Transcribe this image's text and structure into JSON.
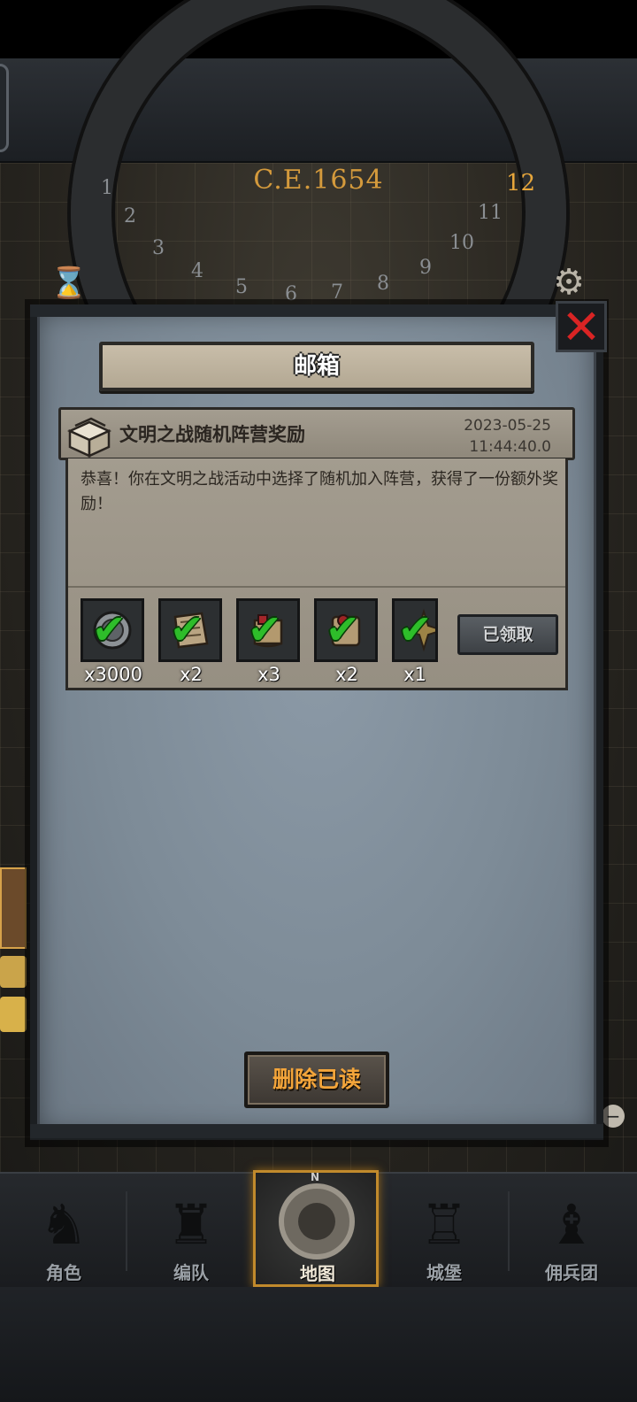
{
  "map": {
    "era_label": "C.E.1654",
    "dial_numbers": [
      "1",
      "2",
      "3",
      "4",
      "5",
      "6",
      "7",
      "8",
      "9",
      "10",
      "11",
      "12"
    ],
    "active_month": "12"
  },
  "mailbox": {
    "title": "邮箱",
    "close_icon": "close-x-icon",
    "mail": {
      "icon": "treasure-chest-icon",
      "title": "文明之战随机阵营奖励",
      "date": "2023-05-25",
      "time": "11:44:40.0",
      "body": "恭喜！你在文明之战活动中选择了随机加入阵营，获得了一份额外奖励！",
      "rewards": [
        {
          "icon": "silver-coin-icon",
          "qty": "x3000",
          "claimed": true
        },
        {
          "icon": "parchment-icon",
          "qty": "x2",
          "claimed": true
        },
        {
          "icon": "scroll-bundle-icon",
          "qty": "x3",
          "claimed": true
        },
        {
          "icon": "sealed-scroll-icon",
          "qty": "x2",
          "claimed": true
        },
        {
          "icon": "star-badge-icon",
          "qty": "x1",
          "claimed": true
        }
      ],
      "claimed_label": "已领取"
    },
    "delete_read_label": "删除已读"
  },
  "bottom_nav": {
    "items": [
      {
        "label": "角色",
        "icon": "knight-icon",
        "active": false
      },
      {
        "label": "编队",
        "icon": "helmet-icon",
        "active": false
      },
      {
        "label": "地图",
        "icon": "compass-icon",
        "active": true
      },
      {
        "label": "城堡",
        "icon": "castle-icon",
        "active": false
      },
      {
        "label": "佣兵团",
        "icon": "mercenary-icon",
        "active": false
      }
    ],
    "compass_n": "N"
  },
  "colors": {
    "accent_orange": "#f4a53a",
    "claimed_check": "#2ebd2a",
    "close_red": "#d92424"
  }
}
